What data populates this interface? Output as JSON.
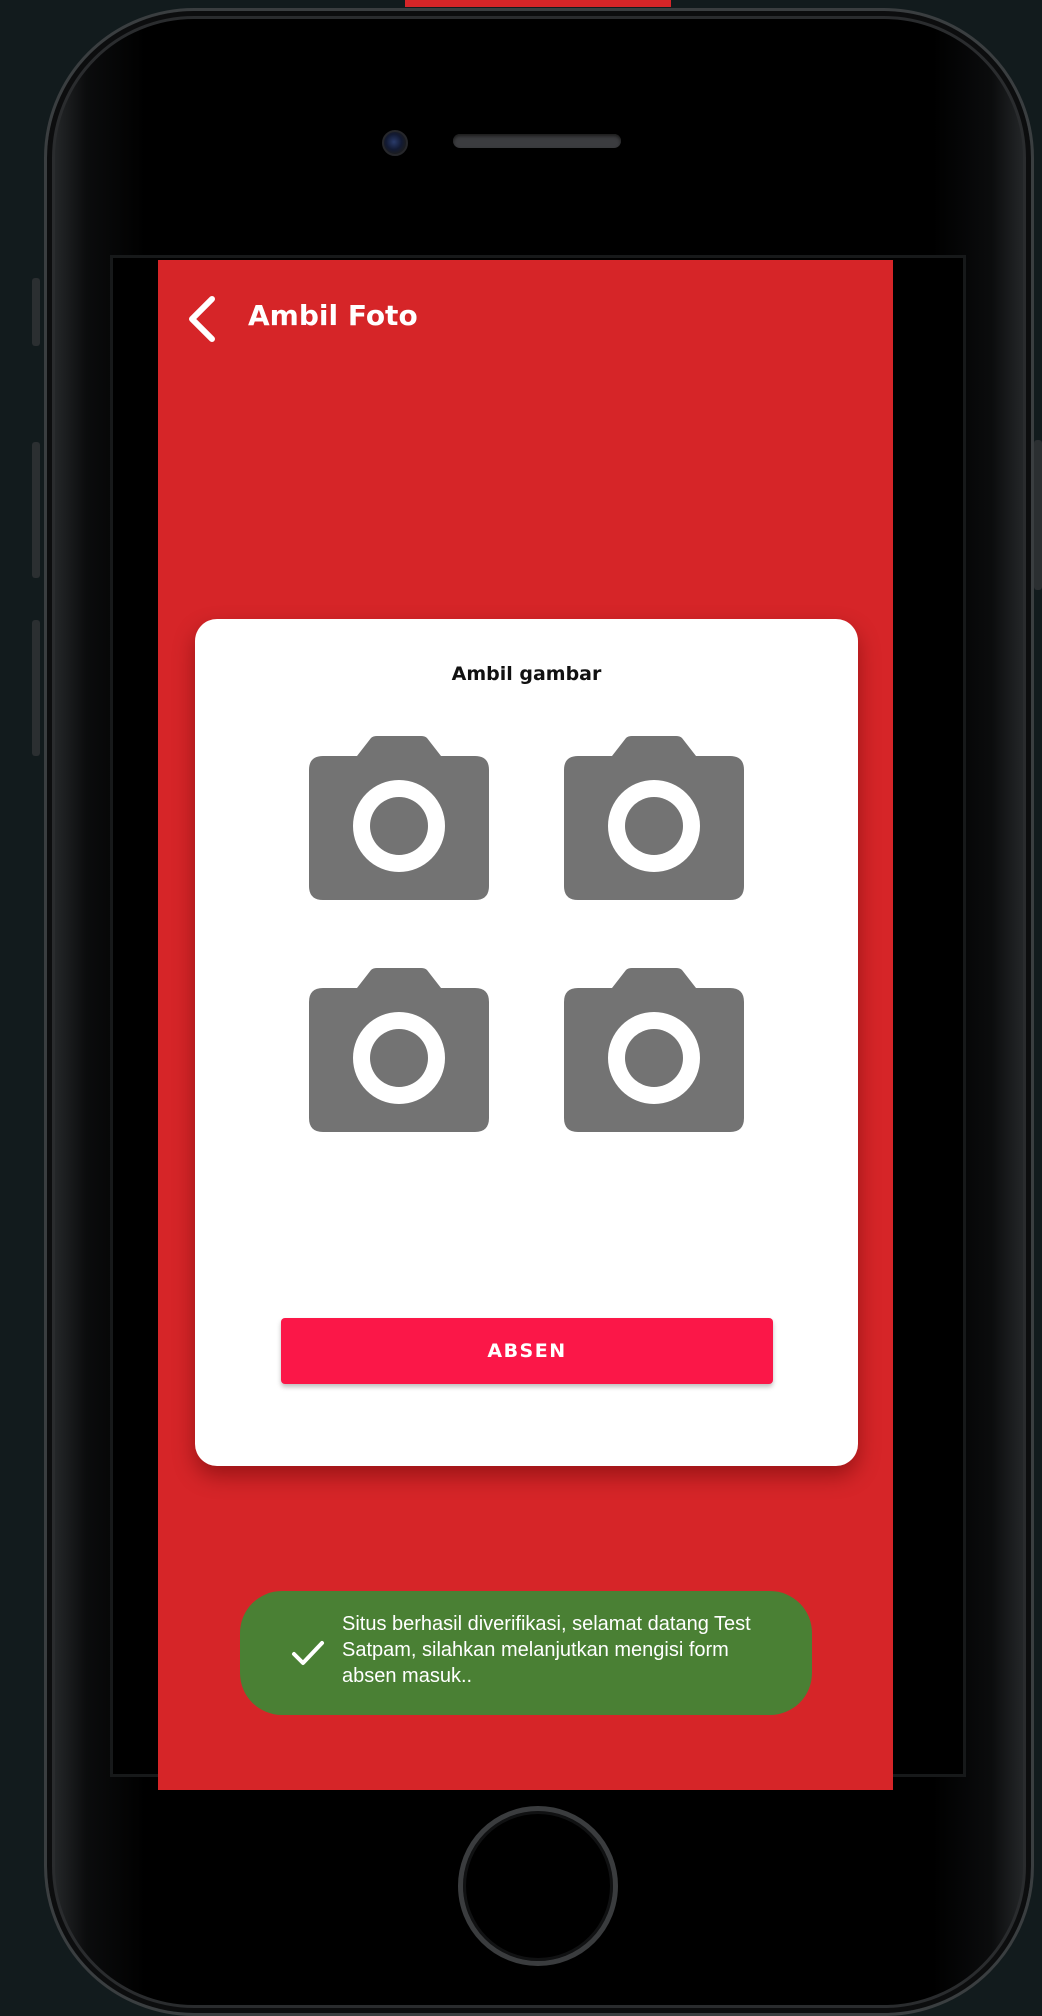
{
  "appbar": {
    "title": "Ambil Foto",
    "back_icon": "chevron-left-icon"
  },
  "card": {
    "title": "Ambil gambar",
    "photo_slots": [
      {
        "icon": "camera-icon"
      },
      {
        "icon": "camera-icon"
      },
      {
        "icon": "camera-icon"
      },
      {
        "icon": "camera-icon"
      }
    ],
    "submit_label": "ABSEN"
  },
  "toast": {
    "icon": "check-icon",
    "message": "Situs berhasil diverifikasi, selamat datang Test Satpam, silahkan melanjutkan mengisi form absen masuk.."
  },
  "colors": {
    "screen_bg": "#d62528",
    "button_bg": "#fb1748",
    "toast_bg": "#4a8034",
    "camera_icon": "#737373"
  }
}
